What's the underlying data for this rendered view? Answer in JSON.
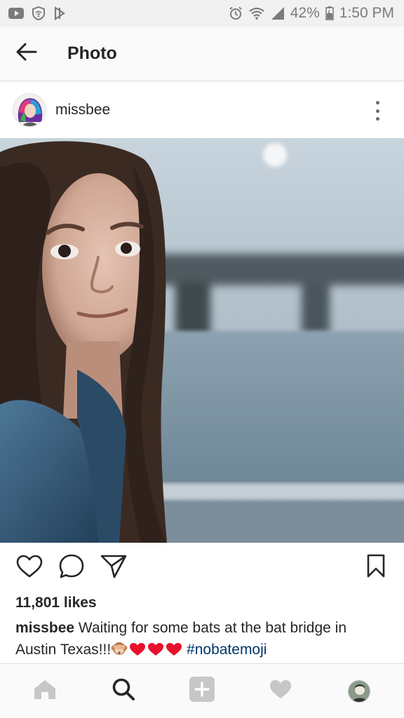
{
  "status_bar": {
    "battery": "42%",
    "time": "1:50 PM",
    "left_icons": [
      "youtube-icon",
      "shield-wifi-icon",
      "voicemail-icon"
    ],
    "right_icons": [
      "alarm-icon",
      "wifi-icon",
      "signal-icon",
      "battery-icon"
    ]
  },
  "app_bar": {
    "title": "Photo",
    "back_icon": "arrow-left-icon"
  },
  "post": {
    "username": "missbee",
    "more_icon": "vertical-ellipsis-icon",
    "likes": "11,801 likes",
    "caption": {
      "username": "missbee",
      "text": "Waiting for some bats at the bat bridge in Austin Texas!!!",
      "emojis": [
        "see-no-evil-monkey",
        "red-heart",
        "red-heart",
        "red-heart"
      ],
      "hashtag": "#nobatemoji"
    },
    "actions": [
      "heart-icon",
      "comment-icon",
      "share-icon",
      "bookmark-icon"
    ]
  },
  "bottom_nav": {
    "items": [
      "home-icon",
      "search-icon",
      "add-icon",
      "activity-heart-icon",
      "profile-avatar"
    ],
    "active": "search-icon"
  },
  "colors": {
    "hashtag": "#003569",
    "text": "#262626",
    "heart_emoji": "#e8112d",
    "icon_inactive": "#c7c7c7"
  }
}
